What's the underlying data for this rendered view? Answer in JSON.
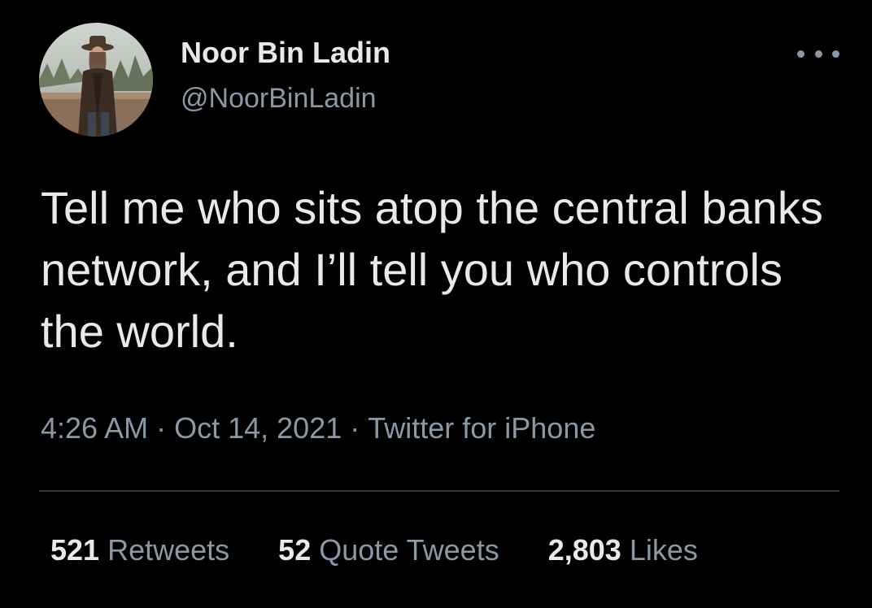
{
  "author": {
    "display_name": "Noor Bin Ladin",
    "handle": "@NoorBinLadin"
  },
  "tweet": {
    "text": "Tell me who sits atop the central banks network, and I’ll tell you who controls the world.",
    "time": "4:26 AM",
    "date": "Oct 14, 2021",
    "source": "Twitter for iPhone",
    "separator": "·"
  },
  "stats": {
    "retweets_count": "521",
    "retweets_label": "Retweets",
    "quotes_count": "52",
    "quotes_label": "Quote Tweets",
    "likes_count": "2,803",
    "likes_label": "Likes"
  },
  "icons": {
    "more": "more-options-icon",
    "avatar": "profile-photo"
  },
  "colors": {
    "background": "#000000",
    "primary_text": "#e7e9ea",
    "secondary_text": "#8b98a5",
    "divider": "#2f3336"
  }
}
